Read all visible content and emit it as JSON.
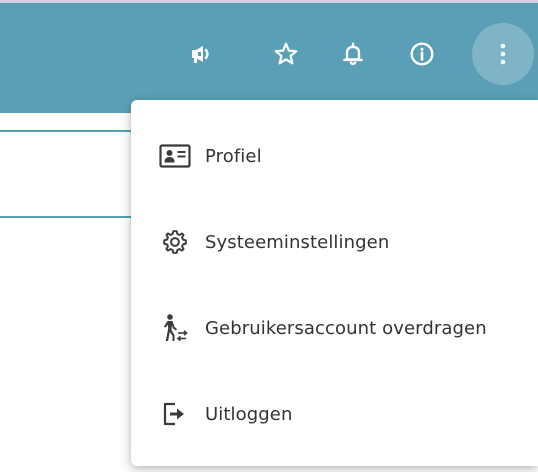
{
  "header": {
    "background_color": "#5b9fb6",
    "icons": [
      {
        "name": "megaphone-icon"
      },
      {
        "name": "star-icon"
      },
      {
        "name": "bell-icon"
      },
      {
        "name": "info-icon"
      },
      {
        "name": "more-vertical-icon"
      }
    ]
  },
  "menu": {
    "items": [
      {
        "label": "Profiel",
        "icon": "id-card-icon"
      },
      {
        "label": "Systeeminstellingen",
        "icon": "gear-icon"
      },
      {
        "label": "Gebruikersaccount overdragen",
        "icon": "person-transfer-icon"
      },
      {
        "label": "Uitloggen",
        "icon": "logout-icon"
      }
    ]
  }
}
